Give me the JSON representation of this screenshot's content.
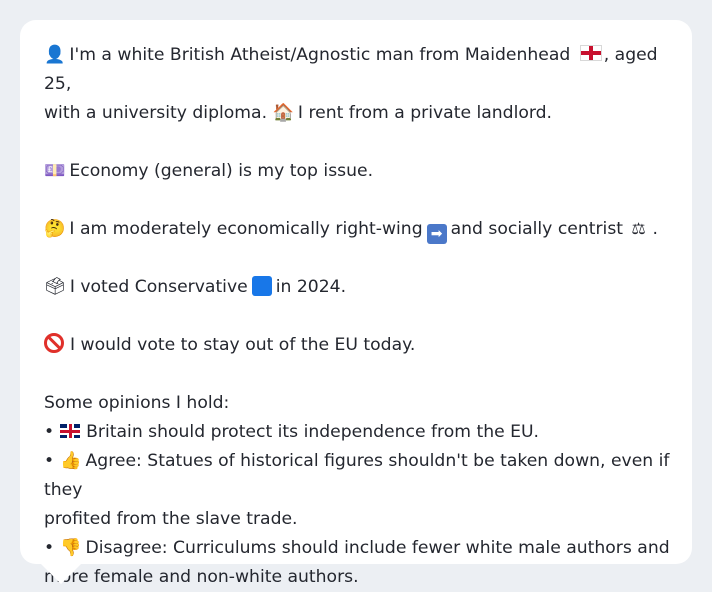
{
  "profile": {
    "intro": {
      "person_icon": "👤",
      "text_before_flag": "I'm a white British Atheist/Agnostic man from Maidenhead",
      "text_after_flag": ", aged 25,",
      "line2_before_house": "with a university diploma.",
      "house_icon": "🏠",
      "line2_after_house": "I rent from a private landlord."
    },
    "issue": {
      "icon": "💷",
      "text": "Economy (general) is my top issue."
    },
    "ideology": {
      "icon": "🤔",
      "text_before_arrow": "I am moderately economically right-wing",
      "arrow_icon": "➡",
      "text_after_arrow": "and socially centrist",
      "scales_icon": "⚖",
      "end": "."
    },
    "vote": {
      "icon": "🗳",
      "text_before": "I voted Conservative",
      "text_after": "in 2024."
    },
    "eu": {
      "text": "I would vote to stay out of the EU today."
    },
    "opinions": {
      "heading": "Some opinions I hold:",
      "bullet": "•",
      "items": [
        {
          "icon": "🇬🇧",
          "line1": "Britain should protect its independence from the EU."
        },
        {
          "icon": "👍",
          "line1": "Agree: Statues of historical figures shouldn't be taken down, even if they",
          "line2": "profited from the slave trade."
        },
        {
          "icon": "👎",
          "line1": "Disagree: Curriculums should include fewer white male authors and",
          "line2": "more female and non-white authors."
        }
      ]
    }
  },
  "colors": {
    "background": "#eceff3",
    "bubble": "#ffffff",
    "text": "#24272f",
    "conservative_blue": "#1877e8",
    "no_red": "#e0302a"
  }
}
